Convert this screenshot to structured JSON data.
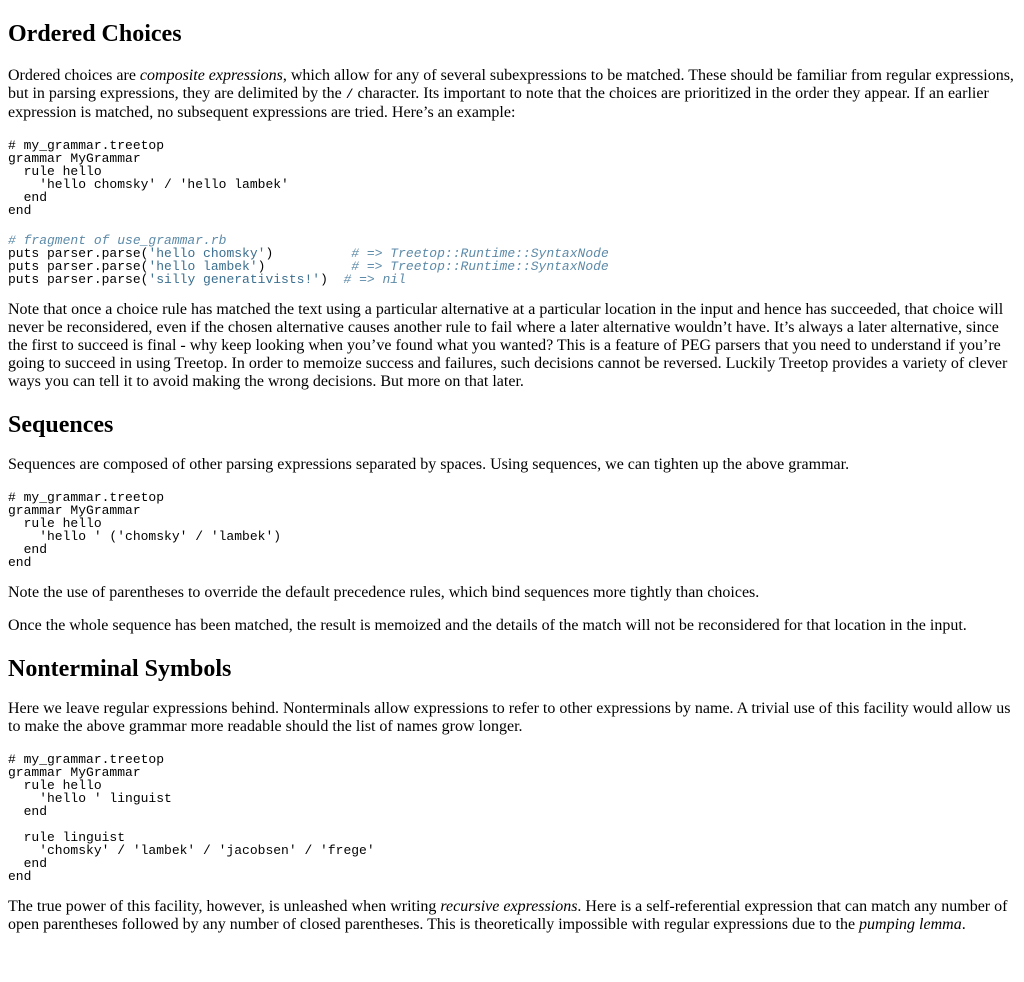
{
  "sections": {
    "ordered": {
      "heading": "Ordered Choices",
      "p1": {
        "a": "Ordered choices are ",
        "em": "composite expressions",
        "b": ", which allow for any of several subexpressions to be matched. These should be familiar from regular expressions, but in parsing expressions, they are delimited by the ",
        "code": "/",
        "c": " character. Its important to note that the choices are prioritized in the order they appear. If an earlier expression is matched, no subsequent expressions are tried. Here’s an example:"
      },
      "code1": [
        "# my_grammar.treetop",
        "grammar MyGrammar",
        "  rule hello",
        "    'hello chomsky' / 'hello lambek'",
        "  end",
        "end"
      ],
      "code2": {
        "comment": "# fragment of use_grammar.rb",
        "lines": [
          {
            "prefix": "puts parser.parse(",
            "str": "'hello chomsky'",
            "suffix": ")          ",
            "result": "# => Treetop::Runtime::SyntaxNode"
          },
          {
            "prefix": "puts parser.parse(",
            "str": "'hello lambek'",
            "suffix": ")           ",
            "result": "# => Treetop::Runtime::SyntaxNode"
          },
          {
            "prefix": "puts parser.parse(",
            "str": "'silly generativists!'",
            "suffix": ")  ",
            "result": "# => nil"
          }
        ]
      },
      "p2": "Note that once a choice rule has matched the text using a particular alternative at a particular location in the input and hence has succeeded, that choice will never be reconsidered, even if the chosen alternative causes another rule to fail where a later alternative wouldn’t have. It’s always a later alternative, since the first to succeed is final - why keep looking when you’ve found what you wanted? This is a feature of PEG parsers that you need to understand if you’re going to succeed in using Treetop. In order to memoize success and failures, such decisions cannot be reversed. Luckily Treetop provides a variety of clever ways you can tell it to avoid making the wrong decisions. But more on that later."
    },
    "sequences": {
      "heading": "Sequences",
      "p1": "Sequences are composed of other parsing expressions separated by spaces. Using sequences, we can tighten up the above grammar.",
      "code": [
        "# my_grammar.treetop",
        "grammar MyGrammar",
        "  rule hello",
        "    'hello ' ('chomsky' / 'lambek')",
        "  end",
        "end"
      ],
      "p2": "Note the use of parentheses to override the default precedence rules, which bind sequences more tightly than choices.",
      "p3": "Once the whole sequence has been matched, the result is memoized and the details of the match will not be reconsidered for that location in the input."
    },
    "nonterminal": {
      "heading": "Nonterminal Symbols",
      "p1": "Here we leave regular expressions behind. Nonterminals allow expressions to refer to other expressions by name. A trivial use of this facility would allow us to make the above grammar more readable should the list of names grow longer.",
      "code": [
        "# my_grammar.treetop",
        "grammar MyGrammar",
        "  rule hello",
        "    'hello ' linguist",
        "  end",
        "",
        "  rule linguist",
        "    'chomsky' / 'lambek' / 'jacobsen' / 'frege'",
        "  end",
        "end"
      ],
      "p2": {
        "a": "The true power of this facility, however, is unleashed when writing ",
        "em1": "recursive expressions",
        "b": ". Here is a self-referential expression that can match any number of open parentheses followed by any number of closed parentheses. This is theoretically impossible with regular expressions due to the ",
        "em2": "pumping lemma",
        "c": "."
      }
    }
  },
  "colors": {
    "comment": "#5c8aa8",
    "string": "#3b6f8f"
  }
}
